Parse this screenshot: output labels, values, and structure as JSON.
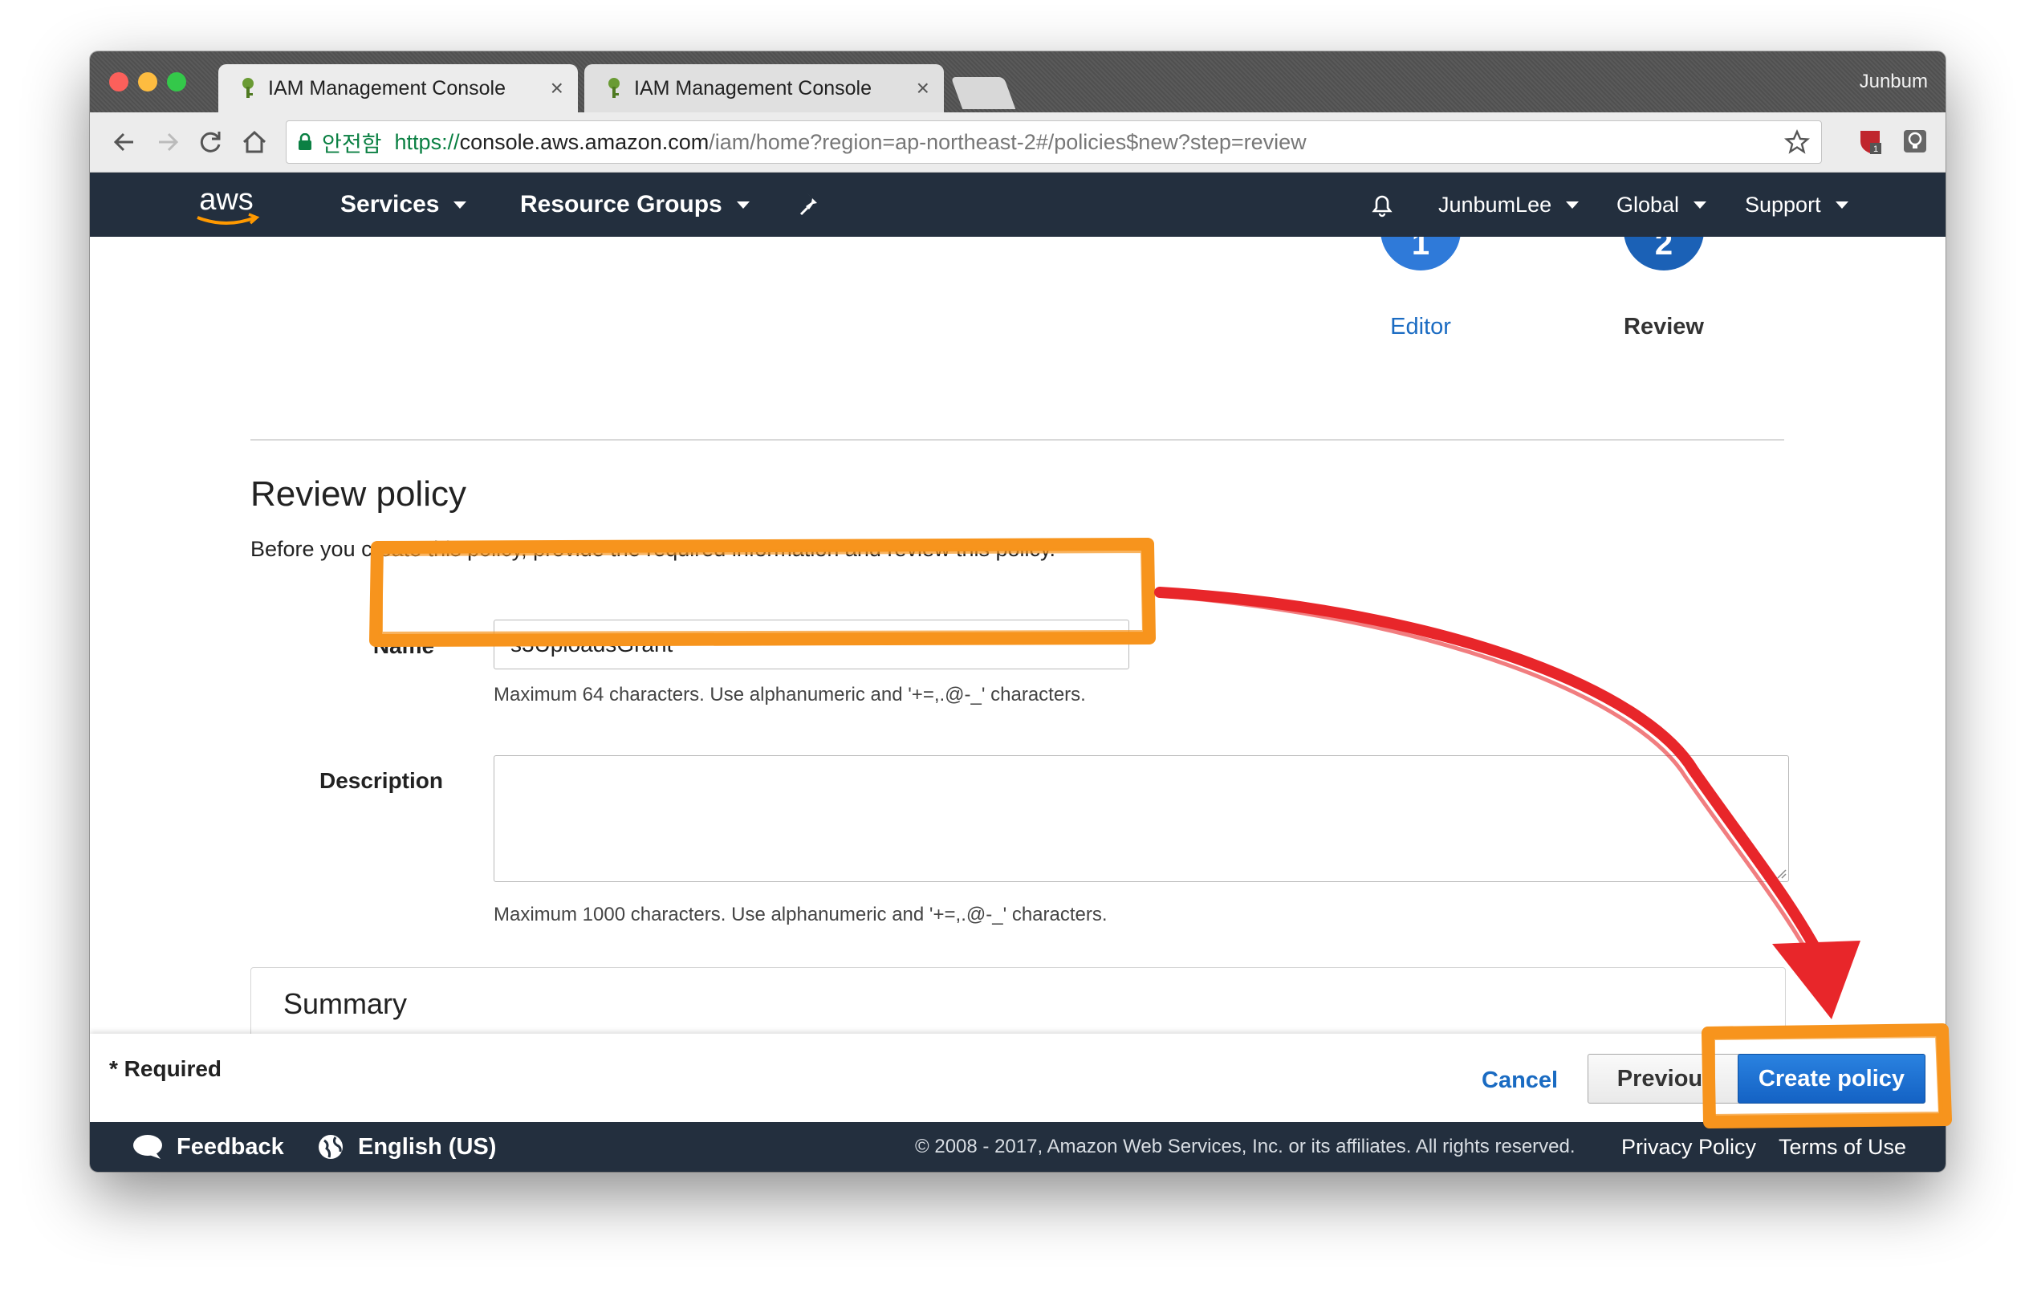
{
  "browser": {
    "tabs": [
      {
        "title": "IAM Management Console",
        "close": "×"
      },
      {
        "title": "IAM Management Console",
        "close": "×"
      }
    ],
    "profile_name": "Junbum",
    "url": {
      "security_label": "안전함",
      "scheme": "https://",
      "host": "console.aws.amazon.com",
      "path": "/iam/home?region=ap-northeast-2#/policies$new?step=review"
    },
    "extension_badge": "1"
  },
  "aws_nav": {
    "logo_text": "aws",
    "services": "Services",
    "resource_groups": "Resource Groups",
    "user": "JunbumLee",
    "region": "Global",
    "support": "Support"
  },
  "steps": [
    {
      "number": "1",
      "label": "Editor"
    },
    {
      "number": "2",
      "label": "Review"
    }
  ],
  "page": {
    "title": "Review policy",
    "description": "Before you create this policy, provide the required information and review this policy.",
    "name_label": "Name*",
    "name_value": "s3UploadsGrant",
    "name_hint": "Maximum 64 characters. Use alphanumeric and '+=,.@-_' characters.",
    "description_label": "Description",
    "description_value": "",
    "description_hint": "Maximum 1000 characters. Use alphanumeric and '+=,.@-_' characters.",
    "summary_title": "Summary"
  },
  "actions": {
    "required_note": "* Required",
    "cancel": "Cancel",
    "previous": "Previous",
    "create": "Create policy"
  },
  "footer": {
    "feedback": "Feedback",
    "language": "English (US)",
    "copyright": "© 2008 - 2017, Amazon Web Services, Inc. or its affiliates. All rights reserved.",
    "privacy": "Privacy Policy",
    "terms": "Terms of Use"
  },
  "colors": {
    "aws_nav": "#232f3e",
    "primary_button": "#1a6bd0",
    "link": "#1a6bc2",
    "highlight_orange": "#f7941d",
    "arrow_red": "#e8262a"
  }
}
